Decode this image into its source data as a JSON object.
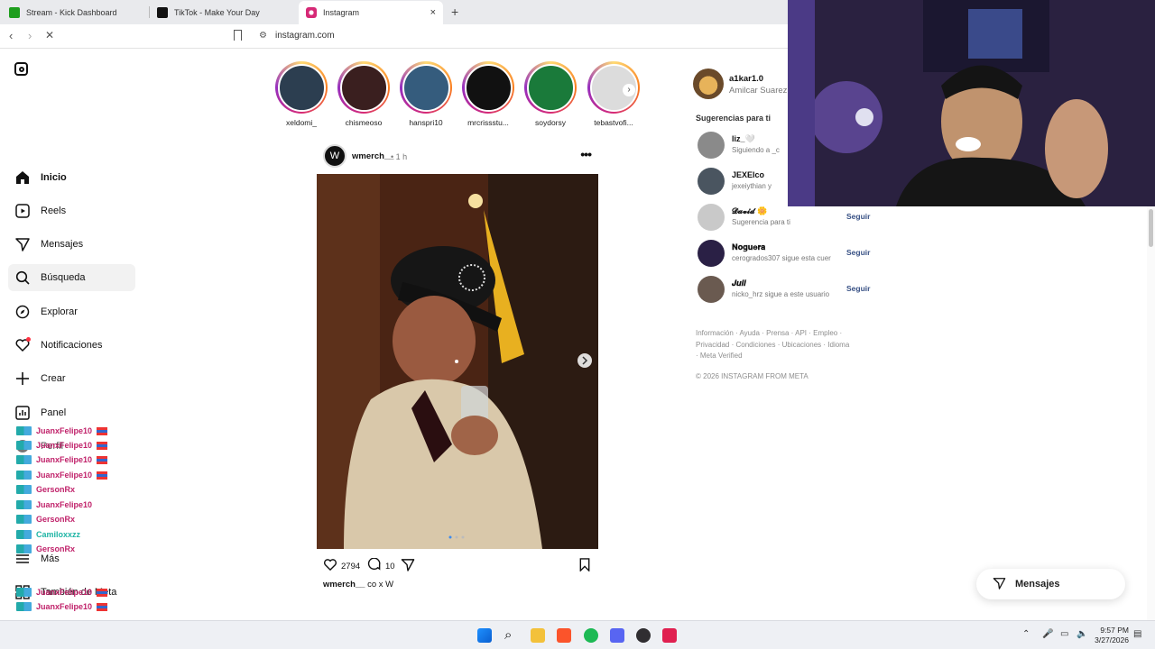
{
  "browser": {
    "tabs": [
      {
        "label": "Stream - Kick Dashboard",
        "color": "#53fc18"
      },
      {
        "label": "TikTok - Make Your Day",
        "color": "#000000"
      },
      {
        "label": "Instagram",
        "color": "#d62976"
      }
    ],
    "url": "instagram.com",
    "newtab_symbol": "+",
    "close_symbol": "×",
    "status_url": "https://www.instagram.com/"
  },
  "sidebar": {
    "items": [
      {
        "label": "Inicio",
        "icon": "home-icon"
      },
      {
        "label": "Reels",
        "icon": "reels-icon"
      },
      {
        "label": "Mensajes",
        "icon": "paper-plane-icon"
      },
      {
        "label": "Búsqueda",
        "icon": "search-icon"
      },
      {
        "label": "Explorar",
        "icon": "compass-icon"
      },
      {
        "label": "Notificaciones",
        "icon": "heart-icon"
      },
      {
        "label": "Crear",
        "icon": "plus-icon"
      },
      {
        "label": "Panel",
        "icon": "chart-icon"
      },
      {
        "label": "Perfil",
        "icon": "avatar-icon"
      },
      {
        "label": "Más",
        "icon": "menu-icon"
      },
      {
        "label": "También de Meta",
        "icon": "grid-icon"
      }
    ]
  },
  "chat": {
    "lines": [
      {
        "user": "JuanxFelipe10",
        "color": "#c0226a",
        "flag": true
      },
      {
        "user": "JuanxFelipe10",
        "color": "#c0226a",
        "flag": true
      },
      {
        "user": "JuanxFelipe10",
        "color": "#c0226a",
        "flag": true
      },
      {
        "user": "JuanxFelipe10",
        "color": "#c0226a",
        "flag": true
      },
      {
        "user": "GersonRx",
        "color": "#c0226a",
        "flag": false
      },
      {
        "user": "JuanxFelipe10",
        "color": "#c0226a",
        "flag": false
      },
      {
        "user": "GersonRx",
        "color": "#c0226a",
        "flag": false
      },
      {
        "user": "Camiloxxzz",
        "color": "#1fb5a5",
        "flag": false
      },
      {
        "user": "GersonRx",
        "color": "#c0226a",
        "flag": false
      },
      {
        "user": "JuanxFelipe10",
        "color": "#c0226a",
        "flag": true
      },
      {
        "user": "JuanxFelipe10",
        "color": "#c0226a",
        "flag": true
      }
    ]
  },
  "stories": [
    {
      "name": "xeldomi_"
    },
    {
      "name": "chismeoso"
    },
    {
      "name": "hanspri10"
    },
    {
      "name": "mrcrissstu..."
    },
    {
      "name": "soydorsy"
    },
    {
      "name": "tebastvofi..."
    }
  ],
  "post": {
    "user": "wmerch__",
    "time": "• 1 h",
    "likes": "2794",
    "comments": "10",
    "caption_user": "wmerch__",
    "caption_text": "co x W"
  },
  "profile": {
    "username": "a1kar1.0",
    "fullname": "Amilcar Suarez"
  },
  "suggestions": {
    "title": "Sugerencias para ti",
    "items": [
      {
        "name": "liz_🤍",
        "sub": "Siguiendo a _c",
        "follow": ""
      },
      {
        "name": "JEXElco",
        "sub": "jexeiythian y",
        "follow": ""
      },
      {
        "name": "𝓓𝓪𝓿𝓲𝓭 🌼",
        "sub": "Sugerencia para ti",
        "follow": "Seguir"
      },
      {
        "name": "𝐍𝐨𝐠𝐮𝐞𝐫𝐚",
        "sub": "cerogrados307 sigue esta cuer",
        "follow": "Seguir"
      },
      {
        "name": "𝑱𝒖𝒍𝒊",
        "sub": "nicko_hrz sigue a este usuario",
        "follow": "Seguir"
      }
    ]
  },
  "footer": {
    "links": "Información · Ayuda · Prensa · API · Empleo · Privacidad · Condiciones · Ubicaciones · Idioma · Meta Verified",
    "copyright": "© 2026 INSTAGRAM FROM META"
  },
  "messages_pill": {
    "label": "Mensajes"
  },
  "taskbar": {
    "time": "9:57 PM",
    "date": "3/27/2026"
  }
}
